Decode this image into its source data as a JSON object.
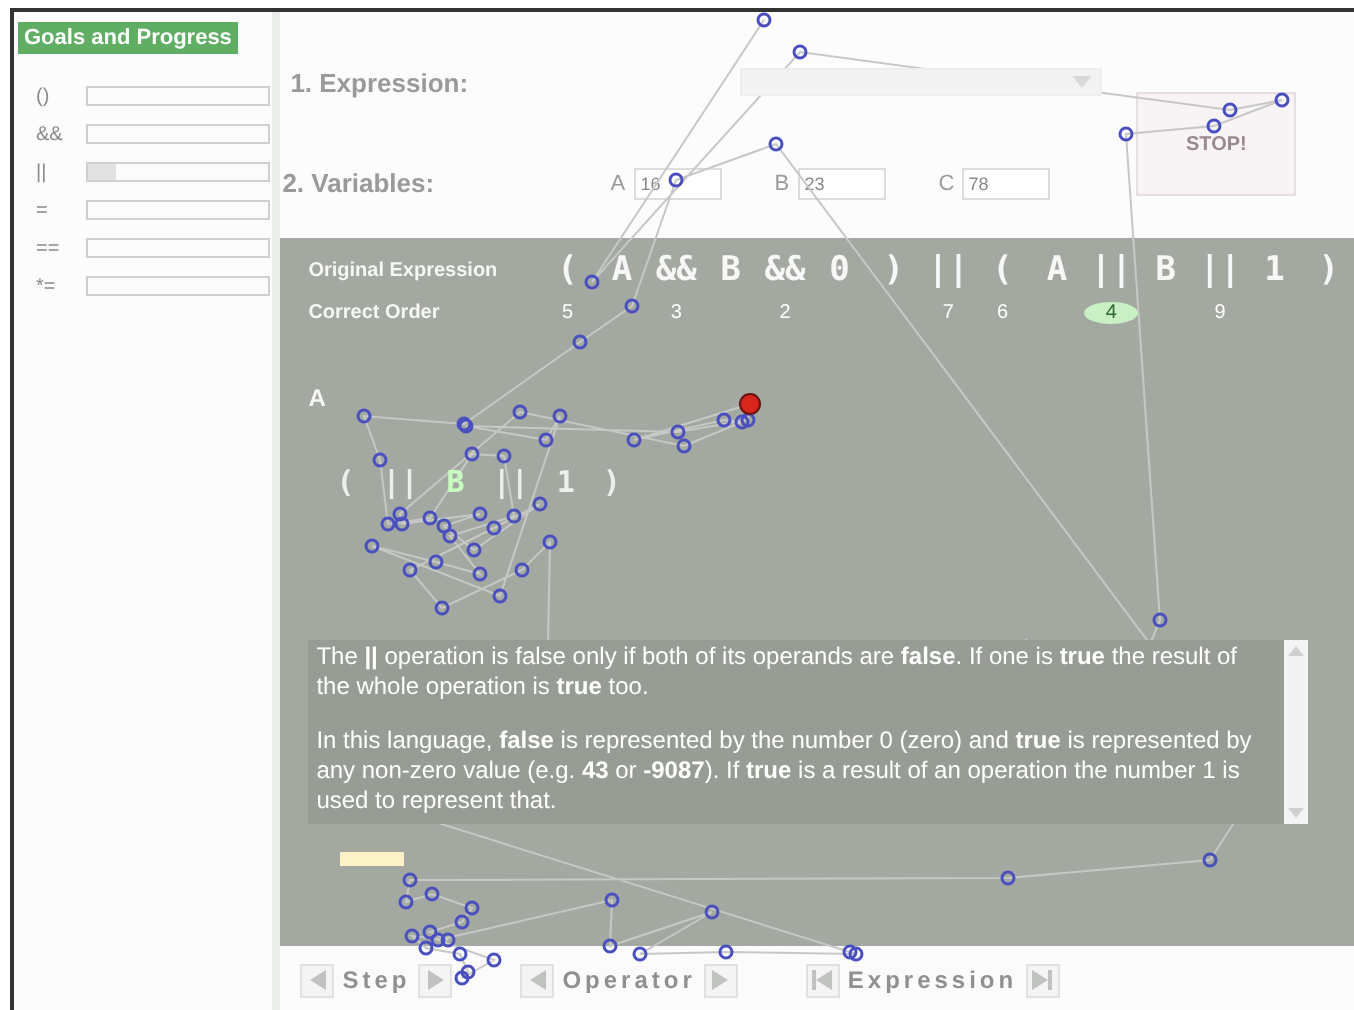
{
  "sidebar": {
    "title": "Goals and Progress",
    "goals": [
      {
        "label": "()",
        "level": 0
      },
      {
        "label": "&&",
        "level": 0
      },
      {
        "label": "||",
        "level": 0.15
      },
      {
        "label": "=",
        "level": 0
      },
      {
        "label": "==",
        "level": 0
      },
      {
        "label": "*=",
        "level": 0
      }
    ]
  },
  "expression": {
    "label": "1. Expression:"
  },
  "stop_button": "STOP!",
  "variables": {
    "label": "2. Variables:",
    "fields": [
      {
        "name": "A",
        "value": "16"
      },
      {
        "name": "B",
        "value": "23"
      },
      {
        "name": "C",
        "value": "78"
      }
    ]
  },
  "panel": {
    "original_label": "Original Expression",
    "order_label": "Correct Order",
    "tokens": [
      {
        "text": "(",
        "order": "5",
        "highlighted": false
      },
      {
        "text": "A"
      },
      {
        "text": "&&",
        "order": "3",
        "highlighted": false
      },
      {
        "text": "B"
      },
      {
        "text": "&&",
        "order": "2",
        "highlighted": false
      },
      {
        "text": "0"
      },
      {
        "text": ")"
      },
      {
        "text": "||",
        "order": "7",
        "highlighted": false
      },
      {
        "text": "(",
        "order": "6",
        "highlighted": false
      },
      {
        "text": "A"
      },
      {
        "text": "||",
        "order": "4",
        "highlighted": true
      },
      {
        "text": "B"
      },
      {
        "text": "||",
        "order": "9",
        "highlighted": false
      },
      {
        "text": "1"
      },
      {
        "text": ")"
      }
    ],
    "step_label": "A",
    "step_tokens": [
      {
        "text": "(",
        "highlighted": false
      },
      {
        "text": "||",
        "highlighted": false
      },
      {
        "text": "B",
        "highlighted": true
      },
      {
        "text": "||",
        "highlighted": false
      },
      {
        "text": "1",
        "highlighted": false
      },
      {
        "text": ")",
        "highlighted": false
      }
    ],
    "help": [
      "The **||** operation is false only if both of its operands are **false**. If one is **true** the result of the whole operation is **true** too.",
      "In this language, **false** is represented by the number 0 (zero) and **true** is represented by any non-zero value (e.g. **43** or **-9087**). If **true** is a result of an operation the number 1 is used to represent that."
    ]
  },
  "footer": [
    {
      "label": "Step"
    },
    {
      "label": "Operator"
    },
    {
      "label": "Expression",
      "kind": "jump"
    }
  ]
}
